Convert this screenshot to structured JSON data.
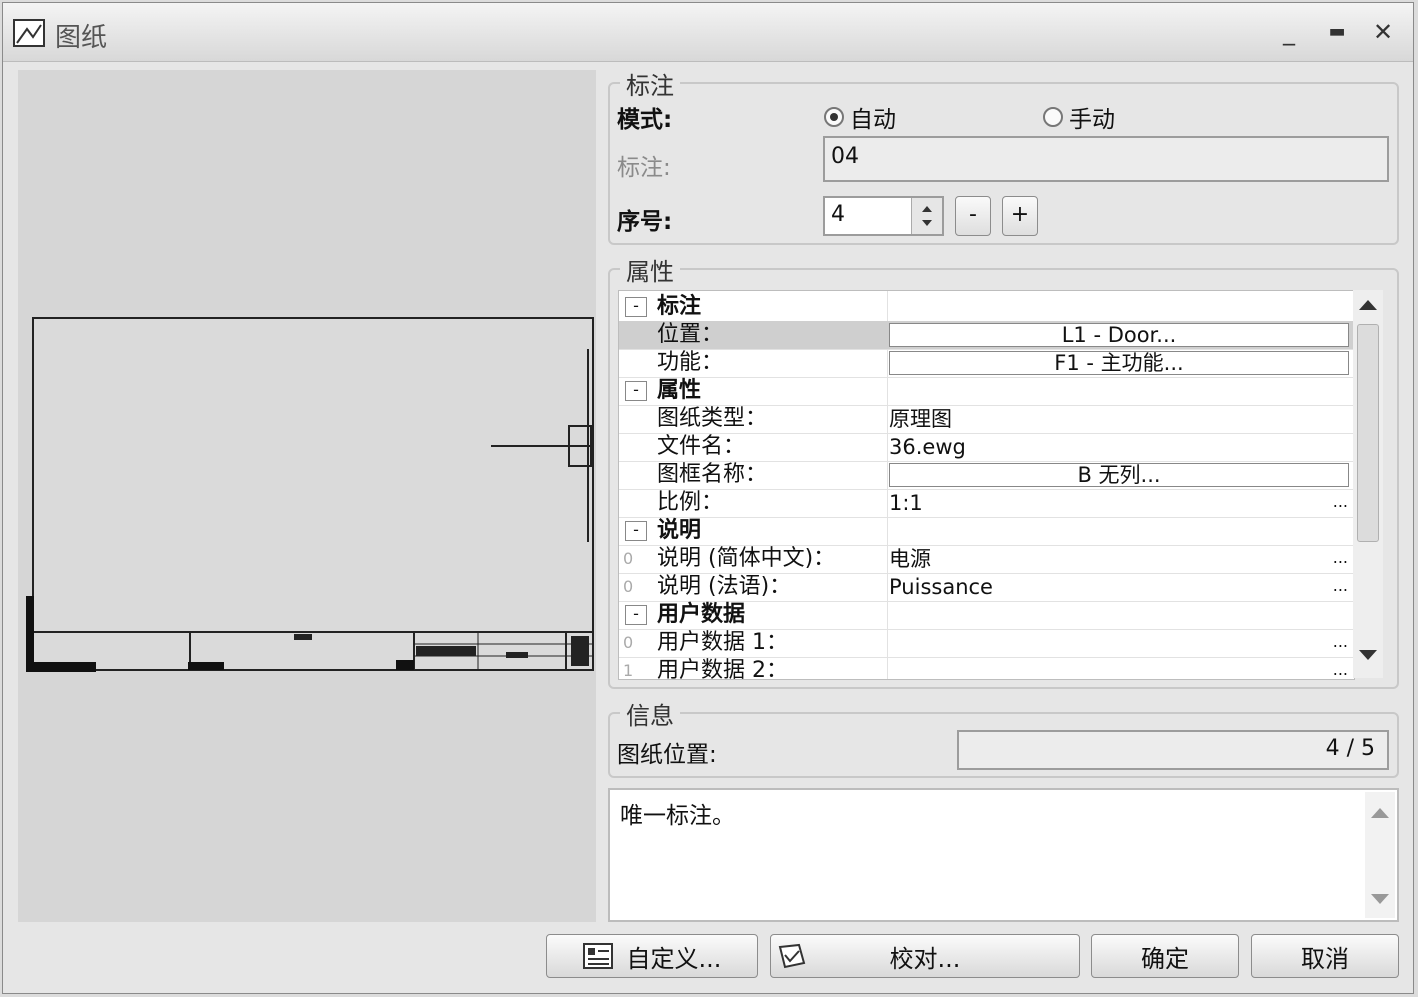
{
  "window": {
    "title": "图纸",
    "minimize": "_",
    "maximize": "▬",
    "close": "✕"
  },
  "annotation": {
    "legend": "标注",
    "mode_label": "模式:",
    "mode_auto": "自动",
    "mode_manual": "手动",
    "mode_selected": "auto",
    "label_label": "标注:",
    "label_value": "04",
    "seq_label": "序号:",
    "seq_value": "4",
    "minus": "-",
    "plus": "+"
  },
  "properties": {
    "legend": "属性",
    "rows": [
      {
        "kind": "cat",
        "toggle": "-",
        "name": "标注"
      },
      {
        "kind": "box",
        "name": "位置：",
        "value": "L1 - Door...",
        "selected": true
      },
      {
        "kind": "box",
        "name": "功能：",
        "value": "F1 - 主功能..."
      },
      {
        "kind": "cat",
        "toggle": "-",
        "name": "属性"
      },
      {
        "kind": "text",
        "name": "图纸类型：",
        "value": "原理图"
      },
      {
        "kind": "text",
        "name": "文件名：",
        "value": "36.ewg"
      },
      {
        "kind": "box",
        "name": "图框名称：",
        "value": "B 无列..."
      },
      {
        "kind": "text",
        "name": "比例：",
        "value": "1:1",
        "dots": "..."
      },
      {
        "kind": "cat",
        "toggle": "-",
        "name": "说明"
      },
      {
        "kind": "text",
        "zero": "0",
        "name": "说明 (简体中文)：",
        "value": "电源",
        "dots": "..."
      },
      {
        "kind": "text",
        "zero": "0",
        "name": "说明 (法语)：",
        "value": "Puissance",
        "dots": "..."
      },
      {
        "kind": "cat",
        "toggle": "-",
        "name": "用户数据"
      },
      {
        "kind": "text",
        "zero": "0",
        "name": "用户数据 1：",
        "value": "",
        "dots": "..."
      },
      {
        "kind": "text",
        "zero": "1",
        "name": "用户数据 2：",
        "value": "",
        "dots": "..."
      }
    ]
  },
  "info": {
    "legend": "信息",
    "position_label": "图纸位置:",
    "position_value": "4 / 5"
  },
  "note": {
    "text": "唯一标注。"
  },
  "buttons": {
    "customize": "自定义...",
    "check": "校对...",
    "ok": "确定",
    "cancel": "取消"
  }
}
